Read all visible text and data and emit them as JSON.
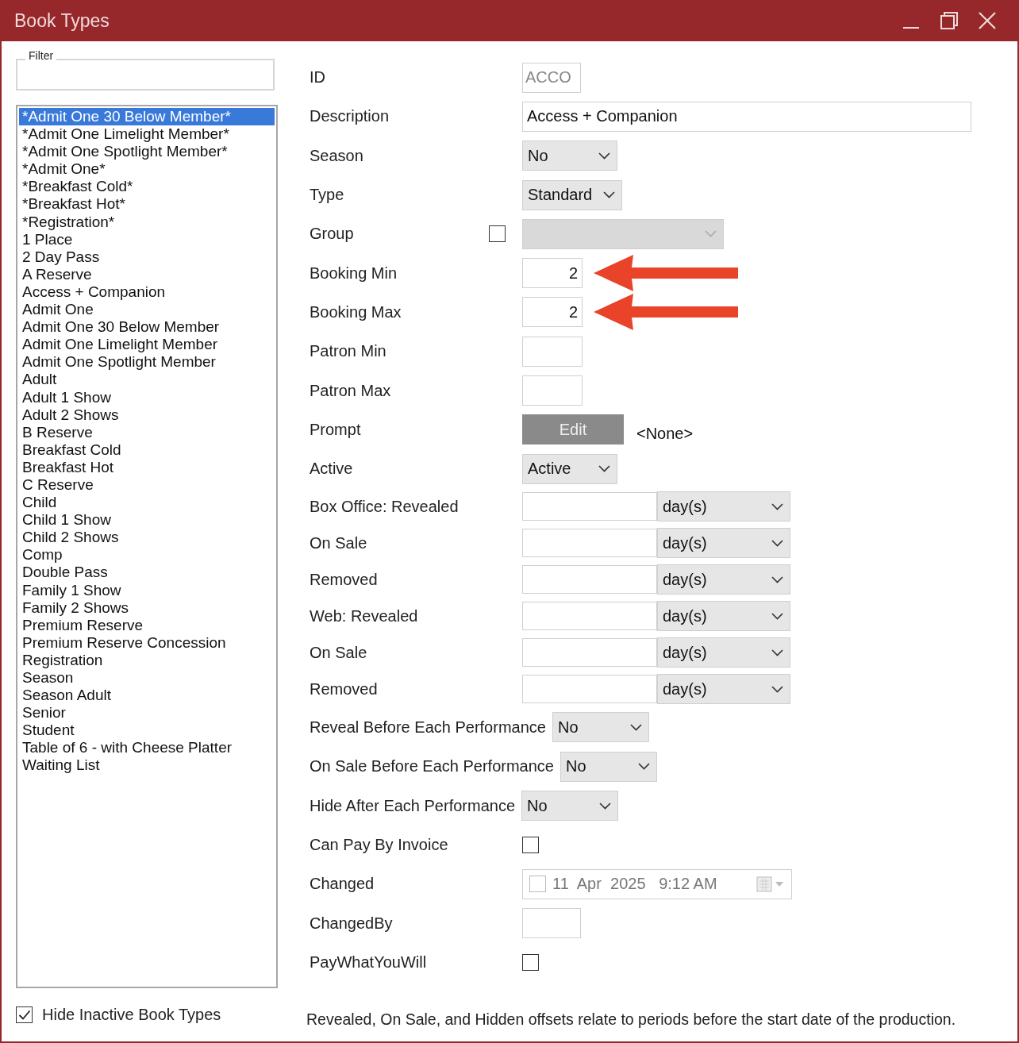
{
  "window": {
    "title": "Book Types"
  },
  "filter": {
    "legend": "Filter"
  },
  "book_types": [
    {
      "label": "*Admit One 30 Below Member*",
      "selected": true
    },
    {
      "label": "*Admit One Limelight Member*",
      "selected": false
    },
    {
      "label": "*Admit One Spotlight Member*",
      "selected": false
    },
    {
      "label": "*Admit One*",
      "selected": false
    },
    {
      "label": "*Breakfast Cold*",
      "selected": false
    },
    {
      "label": "*Breakfast Hot*",
      "selected": false
    },
    {
      "label": "*Registration*",
      "selected": false
    },
    {
      "label": "1 Place",
      "selected": false
    },
    {
      "label": "2 Day Pass",
      "selected": false
    },
    {
      "label": "A Reserve",
      "selected": false
    },
    {
      "label": "Access + Companion",
      "selected": false
    },
    {
      "label": "Admit One",
      "selected": false
    },
    {
      "label": "Admit One 30 Below Member",
      "selected": false
    },
    {
      "label": "Admit One Limelight Member",
      "selected": false
    },
    {
      "label": "Admit One Spotlight Member",
      "selected": false
    },
    {
      "label": "Adult",
      "selected": false
    },
    {
      "label": "Adult 1 Show",
      "selected": false
    },
    {
      "label": "Adult 2 Shows",
      "selected": false
    },
    {
      "label": "B Reserve",
      "selected": false
    },
    {
      "label": "Breakfast Cold",
      "selected": false
    },
    {
      "label": "Breakfast Hot",
      "selected": false
    },
    {
      "label": "C Reserve",
      "selected": false
    },
    {
      "label": "Child",
      "selected": false
    },
    {
      "label": "Child 1 Show",
      "selected": false
    },
    {
      "label": "Child 2 Shows",
      "selected": false
    },
    {
      "label": "Comp",
      "selected": false
    },
    {
      "label": "Double Pass",
      "selected": false
    },
    {
      "label": "Family 1 Show",
      "selected": false
    },
    {
      "label": "Family 2 Shows",
      "selected": false
    },
    {
      "label": "Premium Reserve",
      "selected": false
    },
    {
      "label": "Premium Reserve Concession",
      "selected": false
    },
    {
      "label": "Registration",
      "selected": false
    },
    {
      "label": "Season",
      "selected": false
    },
    {
      "label": "Season Adult",
      "selected": false
    },
    {
      "label": "Senior",
      "selected": false
    },
    {
      "label": "Student",
      "selected": false
    },
    {
      "label": "Table of 6 - with Cheese Platter",
      "selected": false
    },
    {
      "label": "Waiting List",
      "selected": false
    }
  ],
  "hide_inactive": {
    "label": "Hide Inactive Book Types",
    "checked": true
  },
  "fields": [
    {
      "kind": "readonly",
      "label": "ID",
      "value": "ACCO"
    },
    {
      "kind": "text",
      "label": "Description",
      "value": "Access + Companion"
    },
    {
      "kind": "select",
      "label": "Season",
      "value": "No"
    },
    {
      "kind": "select",
      "label": "Type",
      "value": "Standard"
    },
    {
      "kind": "group",
      "label": "Group",
      "checked": false,
      "disabled": true
    },
    {
      "kind": "number",
      "label": "Booking Min",
      "value": "2",
      "arrow": true
    },
    {
      "kind": "number",
      "label": "Booking Max",
      "value": "2",
      "arrow": true
    },
    {
      "kind": "number",
      "label": "Patron Min",
      "arrow": false
    },
    {
      "kind": "number",
      "label": "Patron Max",
      "arrow": false
    },
    {
      "kind": "button",
      "label": "Prompt",
      "button": "Edit",
      "value": "<None>"
    },
    {
      "kind": "select",
      "label": "Active",
      "value": "Active"
    },
    {
      "kind": "offset",
      "label": "Box Office: Revealed",
      "unit": "day(s)"
    },
    {
      "kind": "offset",
      "label": "On Sale",
      "unit": "day(s)"
    },
    {
      "kind": "offset",
      "label": "Removed",
      "unit": "day(s)"
    },
    {
      "kind": "offset",
      "label": "Web: Revealed",
      "unit": "day(s)"
    },
    {
      "kind": "offset",
      "label": "On Sale",
      "unit": "day(s)"
    },
    {
      "kind": "offset",
      "label": "Removed",
      "unit": "day(s)"
    },
    {
      "kind": "inline-select",
      "label": "Reveal Before Each Performance",
      "value": "No"
    },
    {
      "kind": "inline-select",
      "label": "On Sale Before Each Performance",
      "value": "No"
    },
    {
      "kind": "inline-select",
      "label": "Hide After Each Performance",
      "value": "No"
    },
    {
      "kind": "checkbox",
      "label": "Can Pay By Invoice",
      "checked": false
    },
    {
      "kind": "datetime",
      "label": "Changed",
      "checked": false,
      "value": "11  Apr  2025   9:12 AM"
    },
    {
      "kind": "readonly",
      "label": "ChangedBy"
    },
    {
      "kind": "checkbox",
      "label": "PayWhatYouWill",
      "checked": false
    }
  ],
  "note": "Revealed, On Sale, and Hidden offsets relate to periods before the start date of the production."
}
